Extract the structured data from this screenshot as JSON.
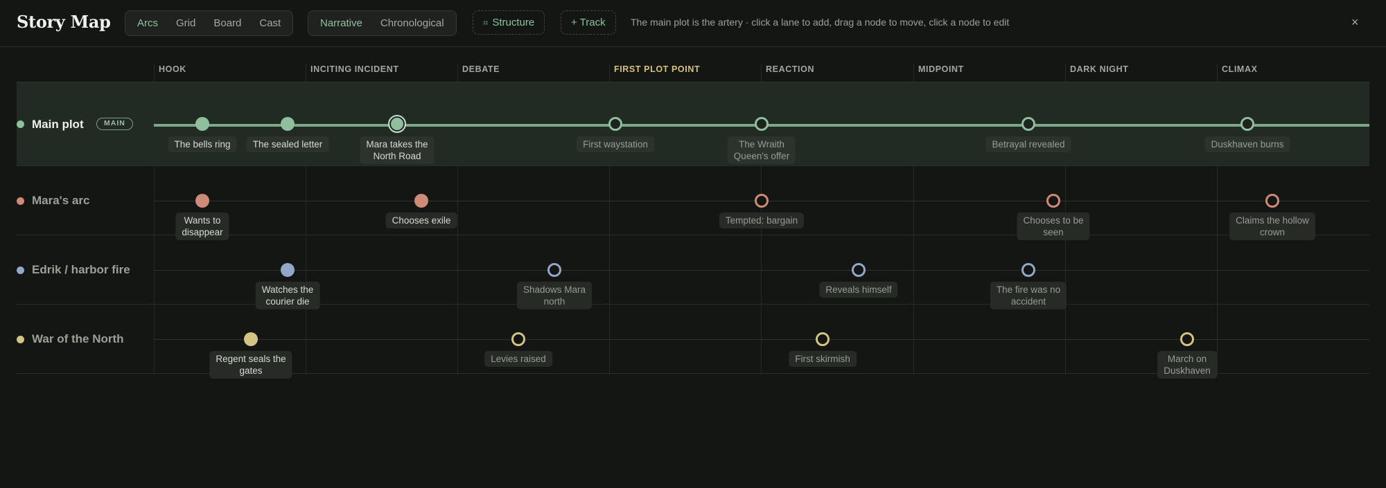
{
  "app": {
    "title": "Story Map"
  },
  "toolbar": {
    "view_tabs": [
      "Arcs",
      "Grid",
      "Board",
      "Cast"
    ],
    "order_tabs": [
      "Narrative",
      "Chronological"
    ],
    "structure_glyph": "⌗",
    "structure_label": "Structure",
    "track_label": "+ Track",
    "hint": "The main plot is the artery · click a lane to add, drag a node to move, click a node to edit",
    "close": "×"
  },
  "columns": [
    "HOOK",
    "INCITING INCIDENT",
    "DEBATE",
    "FIRST PLOT POINT",
    "REACTION",
    "MIDPOINT",
    "DARK NIGHT",
    "CLIMAX"
  ],
  "lanes": {
    "main": {
      "name": "Main plot",
      "badge": "MAIN",
      "nodes": [
        {
          "line1": "The bells ring",
          "line2": ""
        },
        {
          "line1": "The sealed letter",
          "line2": ""
        },
        {
          "line1": "Mara takes the",
          "line2": "North Road"
        },
        {
          "line1": "First waystation",
          "line2": ""
        },
        {
          "line1": "The Wraith",
          "line2": "Queen's offer"
        },
        {
          "line1": "Betrayal revealed",
          "line2": ""
        },
        {
          "line1": "Duskhaven burns",
          "line2": ""
        }
      ]
    },
    "mara": {
      "name": "Mara's arc",
      "nodes": [
        {
          "line1": "Wants to",
          "line2": "disappear"
        },
        {
          "line1": "Chooses exile",
          "line2": ""
        },
        {
          "line1": "Tempted: bargain",
          "line2": ""
        },
        {
          "line1": "Chooses to be",
          "line2": "seen"
        },
        {
          "line1": "Claims the hollow",
          "line2": "crown"
        }
      ]
    },
    "edrik": {
      "name": "Edrik / harbor fire",
      "nodes": [
        {
          "line1": "Watches the",
          "line2": "courier die"
        },
        {
          "line1": "Shadows Mara",
          "line2": "north"
        },
        {
          "line1": "Reveals himself",
          "line2": ""
        },
        {
          "line1": "The fire was no",
          "line2": "accident"
        }
      ]
    },
    "war": {
      "name": "War of the North",
      "nodes": [
        {
          "line1": "Regent seals the",
          "line2": "gates"
        },
        {
          "line1": "Levies raised",
          "line2": ""
        },
        {
          "line1": "First skirmish",
          "line2": ""
        },
        {
          "line1": "March on",
          "line2": "Duskhaven"
        }
      ]
    }
  },
  "colors": {
    "main": "#8fbf9c",
    "mara": "#d08b78",
    "edrik": "#93a8c8",
    "war": "#d1c485",
    "highlight_column": "#d7c27c"
  }
}
